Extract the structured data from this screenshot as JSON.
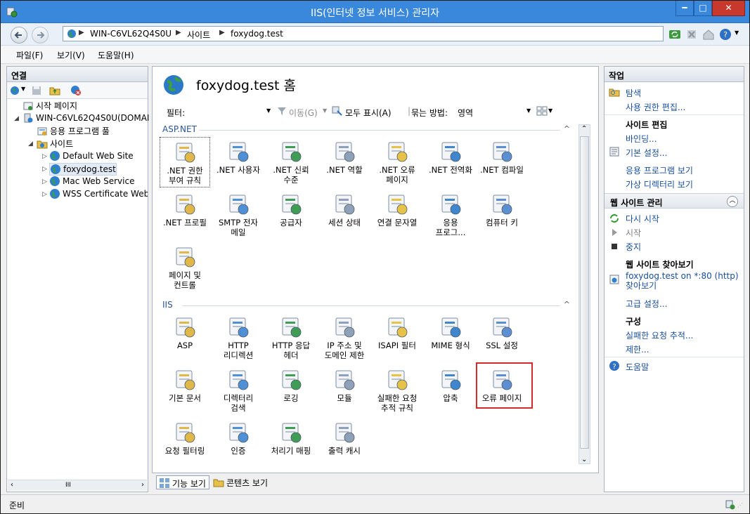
{
  "window": {
    "title": "IIS(인터넷 정보 서비스) 관리자",
    "controls": {
      "minimize": "━",
      "maximize": "□",
      "close": "✕"
    }
  },
  "address": {
    "crumbs": [
      "WIN-C6VL62Q4S0U",
      "사이트",
      "foxydog.test"
    ],
    "separator": "▶"
  },
  "menu": [
    "파일(F)",
    "보기(V)",
    "도움말(H)"
  ],
  "connections": {
    "header": "연결",
    "tree": [
      {
        "label": "시작 페이지"
      },
      {
        "label": "WIN-C6VL62Q4S0U(DOMAI"
      },
      {
        "label": "응용 프로그램 풀"
      },
      {
        "label": "사이트"
      },
      {
        "label": "Default Web Site"
      },
      {
        "label": "foxydog.test"
      },
      {
        "label": "Mac Web Service"
      },
      {
        "label": "WSS Certificate Web S"
      }
    ],
    "scroll_mid": "III"
  },
  "center": {
    "title": "foxydog.test 홈",
    "filter_label": "필터:",
    "move_label": "이동(G)",
    "show_all_label": "모두 표시(A)",
    "group_by_label": "묶는 방법:",
    "group_by_value": "영역",
    "groups": [
      {
        "name": "ASP.NET",
        "features": [
          ".NET 권한\n부여 규칙",
          ".NET 사용자",
          ".NET 신뢰\n수준",
          ".NET 역할",
          ".NET 오류\n페이지",
          ".NET 전역화",
          ".NET 컴파일",
          ".NET 프로필",
          "SMTP 전자\n메일",
          "공급자",
          "세션 상태",
          "연결 문자열",
          "응용\n프로그...",
          "컴퓨터 키",
          "페이지 및\n컨트롤"
        ]
      },
      {
        "name": "IIS",
        "features": [
          "ASP",
          "HTTP\n리디렉션",
          "HTTP 응답\n헤더",
          "IP 주소 및\n도메인 제한",
          "ISAPI 필터",
          "MIME 형식",
          "SSL 설정",
          "기본 문서",
          "디렉터리\n검색",
          "로깅",
          "모듈",
          "실패한 요청\n추적 규칙",
          "압축",
          "오류 페이지",
          "요청 필터링",
          "인증",
          "처리기 매핑",
          "출력 캐시"
        ]
      }
    ],
    "tabs": {
      "features": "기능 보기",
      "content": "콘텐츠 보기"
    }
  },
  "actions": {
    "header": "작업",
    "explore": "탐색",
    "edit_permissions": "사용 권한 편집...",
    "site_edit_head": "사이트 편집",
    "bindings": "바인딩...",
    "basic_settings": "기본 설정...",
    "view_apps": "응용 프로그램 보기",
    "view_vdirs": "가상 디렉터리 보기",
    "manage_head": "웹 사이트 관리",
    "restart": "다시 시작",
    "start": "시작",
    "stop": "중지",
    "browse_head": "웹 사이트 찾아보기",
    "browse_link": "foxydog.test on *:80 (http) 찾아보기",
    "advanced": "고급 설정...",
    "config_head": "구성",
    "failed_tracing": "실패한 요청 추적...",
    "limits": "제한...",
    "help": "도움말"
  },
  "status": {
    "text": "준비"
  },
  "colors": {
    "title_bar": "#3a88dc",
    "link": "#1a4fa0",
    "highlight": "#d52a2a"
  }
}
